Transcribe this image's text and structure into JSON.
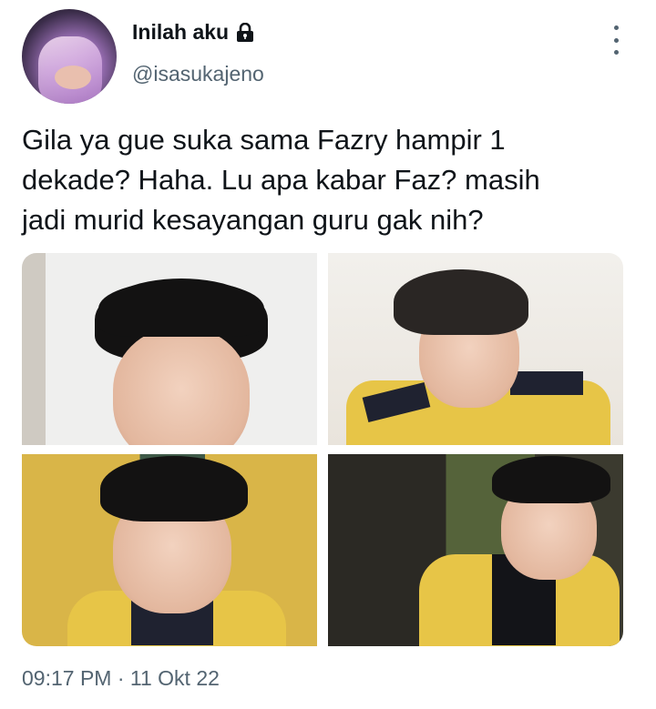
{
  "author": {
    "display_name": "Inilah aku",
    "handle": "@isasukajeno",
    "avatar_icon": "avatar-photo",
    "protected_icon": "lock-icon"
  },
  "tweet": {
    "text": "Gila ya gue suka sama Fazry hampir 1\ndekade? Haha. Lu apa kabar Faz? masih\njadi murid kesayangan guru gak nih?",
    "timestamp": "09:17 PM · 11 Okt 22"
  },
  "media": {
    "count": 4
  },
  "colors": {
    "text": "#0f1419",
    "secondary_text": "#536471",
    "background": "#ffffff"
  }
}
